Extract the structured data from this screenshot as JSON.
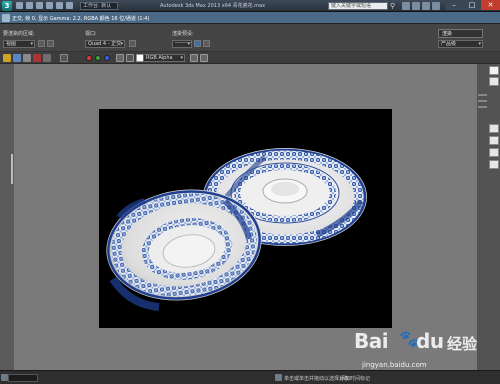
{
  "app": {
    "logo_glyph": "3",
    "workspace": "工作台: 默认",
    "title": "Autodesk 3ds Max 2013 x64    青花瓷花.max",
    "search_placeholder": "键入关键字或短语"
  },
  "render_window": {
    "title": "正交, 帧 0, 显示 Gamma: 2.2, RGBA 颜色 16 位/通道 (1:4)",
    "area_label": "要渲染的区域:",
    "area_value": "视图",
    "viewport_label": "视口:",
    "viewport_value": "Quad 4 - 正交",
    "preset_label": "渲染预设:",
    "preset_value": "--------------------",
    "render_button": "渲染",
    "render_mode": "产品级",
    "channel_display": "RGB Alpha"
  },
  "channels": {
    "red": "#e23a3a",
    "green": "#3aa53a",
    "blue": "#3a5be2"
  },
  "status_bar": {
    "left_value": "",
    "coords": "",
    "hint": "单击或单击并拖动以选择对象",
    "add_time_tag": "添加时间标记"
  },
  "watermark": {
    "logo": "Bai",
    "logo_suffix": "经验",
    "paw": "du",
    "url": "jingyan.baidu.com"
  }
}
